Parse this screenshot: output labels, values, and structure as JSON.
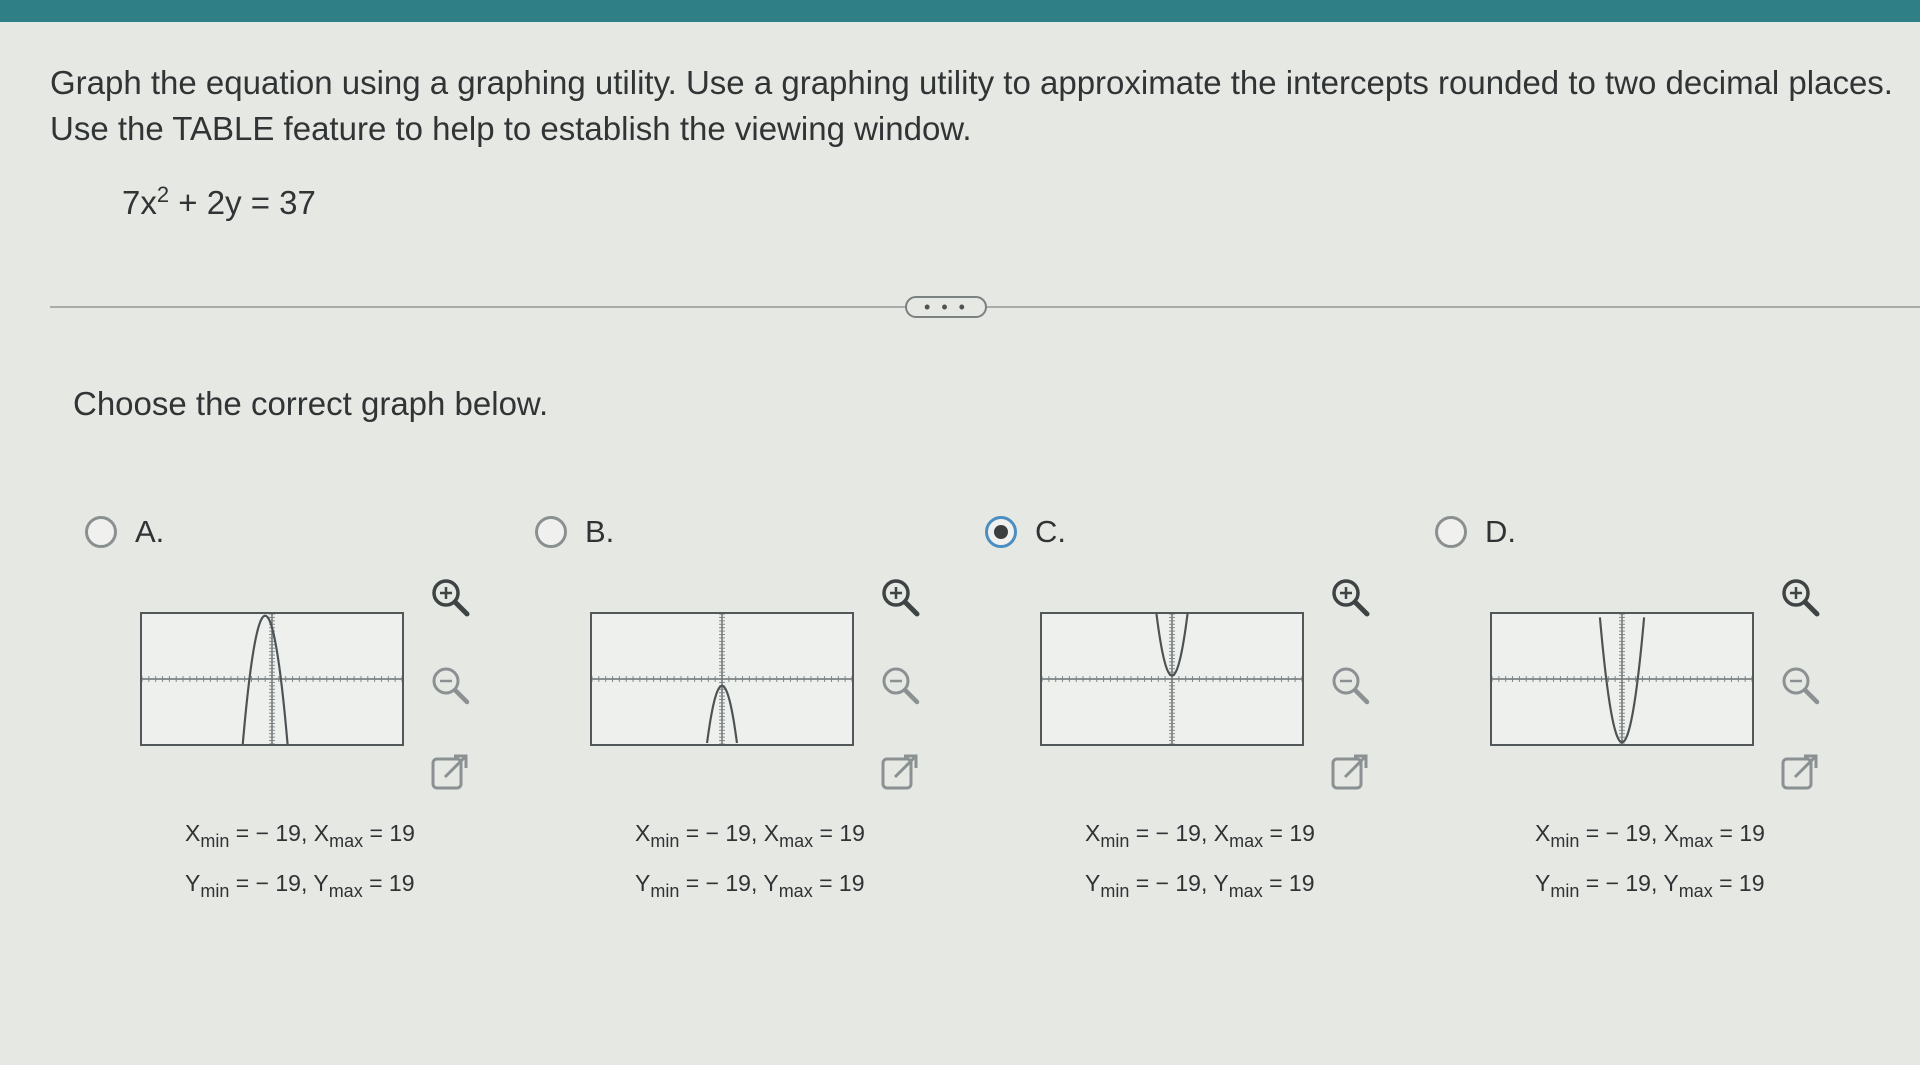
{
  "question": {
    "instructions": "Graph the equation using a graphing utility. Use a graphing utility to approximate the intercepts rounded to two decimal places. Use the TABLE feature to help to establish the viewing window.",
    "equation_part1": "7x",
    "equation_exponent": "2",
    "equation_part2": " + 2y = 37",
    "more_label": "• • •",
    "prompt": "Choose the correct graph below."
  },
  "options": [
    {
      "letter": "A.",
      "selected": false,
      "curve": "parabola-opening-down-shifted-left",
      "x_label": "X",
      "x_min_sub": "min",
      "x_min_value": " = − 19, ",
      "x_max_label": "X",
      "x_max_sub": "max",
      "x_max_value": " = 19",
      "y_label": "Y",
      "y_min_sub": "min",
      "y_min_value": " = − 19, ",
      "y_max_label": "Y",
      "y_max_sub": "max",
      "y_max_value": " = 19"
    },
    {
      "letter": "B.",
      "selected": false,
      "curve": "parabola-opening-down-below-axis",
      "x_label": "X",
      "x_min_sub": "min",
      "x_min_value": " = − 19, ",
      "x_max_label": "X",
      "x_max_sub": "max",
      "x_max_value": " = 19",
      "y_label": "Y",
      "y_min_sub": "min",
      "y_min_value": " = − 19, ",
      "y_max_label": "Y",
      "y_max_sub": "max",
      "y_max_value": " = 19"
    },
    {
      "letter": "C.",
      "selected": true,
      "curve": "parabola-opening-up-above-axis",
      "x_label": "X",
      "x_min_sub": "min",
      "x_min_value": " = − 19, ",
      "x_max_label": "X",
      "x_max_sub": "max",
      "x_max_value": " = 19",
      "y_label": "Y",
      "y_min_sub": "min",
      "y_min_value": " = − 19, ",
      "y_max_label": "Y",
      "y_max_sub": "max",
      "y_max_value": " = 19"
    },
    {
      "letter": "D.",
      "selected": false,
      "curve": "parabola-opening-up-shifted-down",
      "x_label": "X",
      "x_min_sub": "min",
      "x_min_value": " = − 19, ",
      "x_max_label": "X",
      "x_max_sub": "max",
      "x_max_value": " = 19",
      "y_label": "Y",
      "y_min_sub": "min",
      "y_min_value": " = − 19, ",
      "y_max_label": "Y",
      "y_max_sub": "max",
      "y_max_value": " = 19"
    }
  ],
  "icons": {
    "zoom_in": "zoom-in-icon",
    "zoom_out": "zoom-out-icon",
    "popout": "popout-icon"
  },
  "colors": {
    "accent": "#2f7f86",
    "selected_ring": "#4a8ec2"
  }
}
